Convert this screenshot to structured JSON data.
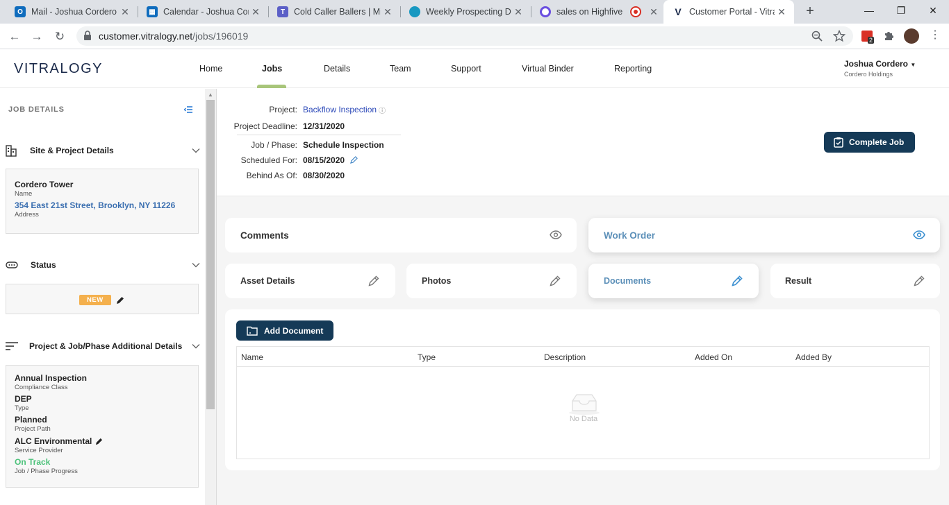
{
  "browser": {
    "tabs": [
      {
        "title": "Mail - Joshua Cordero -",
        "icon": "outlook-icon",
        "color": "#0f6cbd"
      },
      {
        "title": "Calendar - Joshua Cord",
        "icon": "calendar-icon",
        "color": "#0f6cbd"
      },
      {
        "title": "Cold Caller Ballers | Mic",
        "icon": "teams-icon",
        "color": "#5b5fc7"
      },
      {
        "title": "Weekly Prospecting Da",
        "icon": "salesforce-icon",
        "color": "#1798c1"
      },
      {
        "title": "sales on Highfive",
        "icon": "highfive-icon",
        "color": "#6a4fe0"
      },
      {
        "title": "",
        "icon": "record-icon",
        "color": "#d93025"
      },
      {
        "title": "Customer Portal - Vitral",
        "icon": "vitralogy-icon",
        "color": "#1b2a4a"
      }
    ],
    "url_host": "customer.vitralogy.net",
    "url_path": "/jobs/196019",
    "ext_badge": "2"
  },
  "app": {
    "logo": "VITRALOGY",
    "nav": [
      "Home",
      "Jobs",
      "Details",
      "Team",
      "Support",
      "Virtual Binder",
      "Reporting"
    ],
    "active_nav": "Jobs",
    "user_name": "Joshua Cordero",
    "user_org": "Cordero Holdings"
  },
  "sidebar": {
    "title": "JOB DETAILS",
    "site": {
      "heading": "Site & Project Details",
      "name": "Cordero Tower",
      "name_label": "Name",
      "address": "354 East 21st Street, Brooklyn, NY 11226",
      "address_label": "Address"
    },
    "status": {
      "heading": "Status",
      "badge": "NEW"
    },
    "additional": {
      "heading": "Project & Job/Phase Additional Details",
      "items": [
        {
          "value": "Annual Inspection",
          "label": "Compliance Class"
        },
        {
          "value": "DEP",
          "label": "Type"
        },
        {
          "value": "Planned",
          "label": "Project Path"
        },
        {
          "value": "ALC Environmental",
          "label": "Service Provider"
        },
        {
          "value": "On Track",
          "label": "Job / Phase Progress"
        }
      ]
    }
  },
  "job": {
    "project_label": "Project:",
    "project": "Backflow Inspection",
    "deadline_label": "Project Deadline:",
    "deadline": "12/31/2020",
    "phase_label": "Job / Phase:",
    "phase": "Schedule Inspection",
    "scheduled_label": "Scheduled For:",
    "scheduled": "08/15/2020",
    "behind_label": "Behind As Of:",
    "behind": "08/30/2020",
    "complete_button": "Complete Job"
  },
  "tiles": {
    "comments": "Comments",
    "work_order": "Work Order",
    "asset_details": "Asset Details",
    "photos": "Photos",
    "documents": "Documents",
    "result": "Result"
  },
  "documents": {
    "add_button": "Add Document",
    "columns": [
      "Name",
      "Type",
      "Description",
      "Added On",
      "Added By"
    ],
    "empty_text": "No Data"
  },
  "colors": {
    "accent_dark": "#153a57",
    "link": "#2b48b8",
    "active_tile": "#5b8fb8",
    "on_track": "#4cc27a",
    "badge_new": "#f4b04d",
    "nav_indicator": "#a8c57a"
  }
}
